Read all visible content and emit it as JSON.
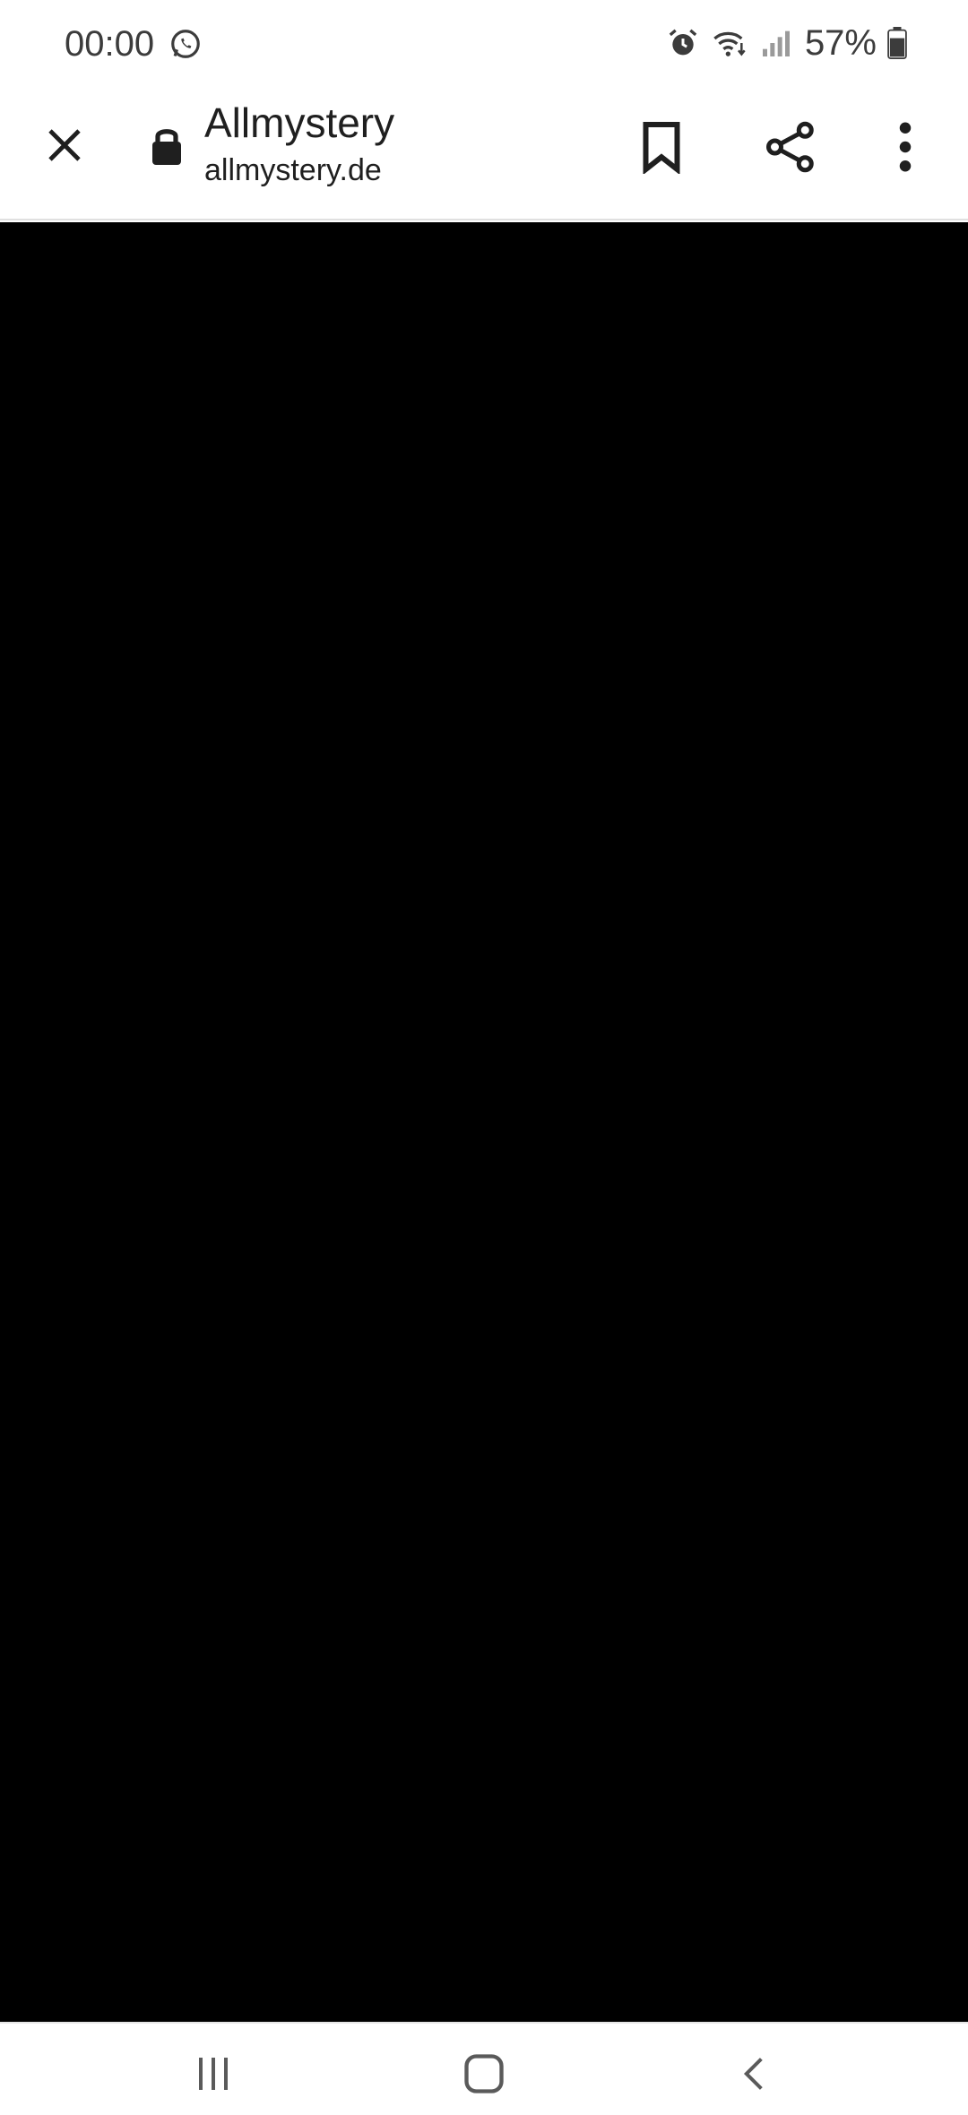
{
  "status_bar": {
    "time": "00:00",
    "battery_percent": "57%",
    "left_icons": [
      "whatsapp-icon"
    ],
    "right_icons": [
      "alarm-icon",
      "wifi-icon",
      "signal-icon",
      "battery-icon"
    ]
  },
  "toolbar": {
    "title": "Allmystery",
    "url": "allmystery.de",
    "icons": [
      "close-icon",
      "lock-icon",
      "bookmark-icon",
      "share-icon",
      "more-vert-icon"
    ]
  },
  "web_content": {
    "background": "#000000"
  },
  "nav_bar": {
    "buttons": [
      "recents-icon",
      "home-icon",
      "back-icon"
    ]
  },
  "colors": {
    "toolbar_bg": "#ffffff",
    "text": "#1f1f1f",
    "status_text": "#3c3c3c",
    "content_bg": "#000000"
  }
}
